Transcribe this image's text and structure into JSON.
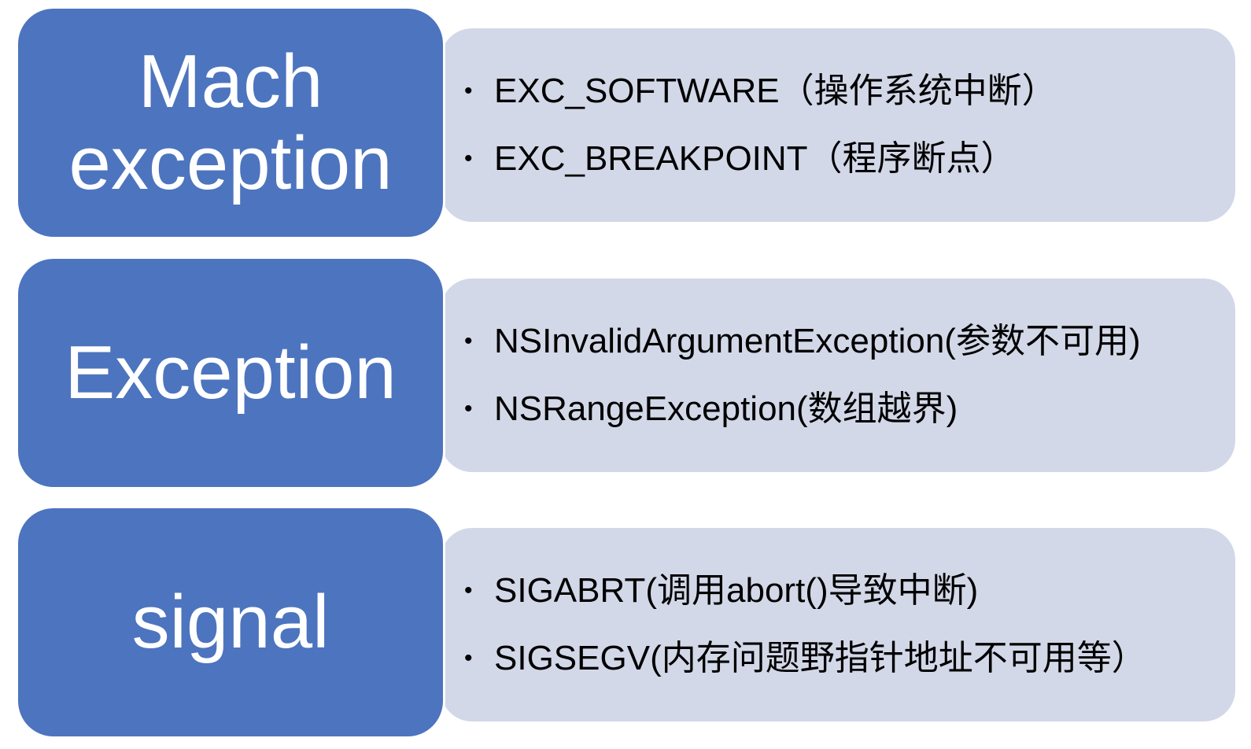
{
  "colors": {
    "label_fill": "#4d74be",
    "detail_fill": "#d3d8e8",
    "label_text": "#ffffff",
    "detail_text": "#000000"
  },
  "rows": [
    {
      "label": "Mach\nexception",
      "items": [
        "EXC_SOFTWARE（操作系统中断）",
        "EXC_BREAKPOINT（程序断点）"
      ]
    },
    {
      "label": "Exception",
      "items": [
        "NSInvalidArgumentException(参数不可用)",
        "NSRangeException(数组越界)"
      ]
    },
    {
      "label": "signal",
      "items": [
        "SIGABRT(调用abort()导致中断)",
        "SIGSEGV(内存问题野指针地址不可用等）"
      ]
    }
  ]
}
